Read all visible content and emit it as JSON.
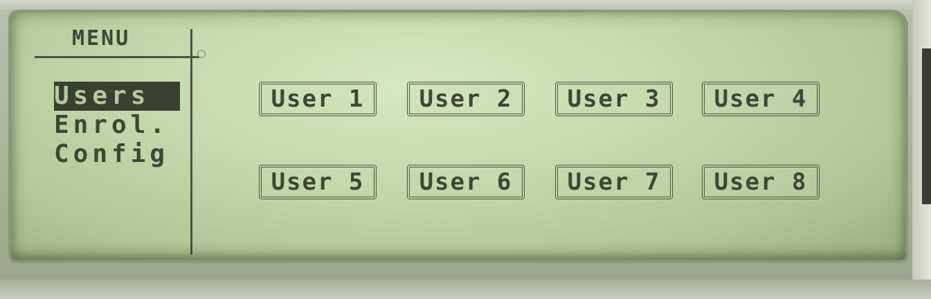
{
  "menu": {
    "title": "MENU",
    "items": [
      {
        "label": "Users",
        "selected": true
      },
      {
        "label": "Enrol."
      },
      {
        "label": "Config"
      }
    ]
  },
  "users": [
    {
      "label": "User 1"
    },
    {
      "label": "User 2"
    },
    {
      "label": "User 3"
    },
    {
      "label": "User 4"
    },
    {
      "label": "User 5"
    },
    {
      "label": "User 6"
    },
    {
      "label": "User 7"
    },
    {
      "label": "User 8"
    }
  ],
  "colors": {
    "lcd_background": "#c6dbb0",
    "lcd_text": "#3f4636"
  }
}
